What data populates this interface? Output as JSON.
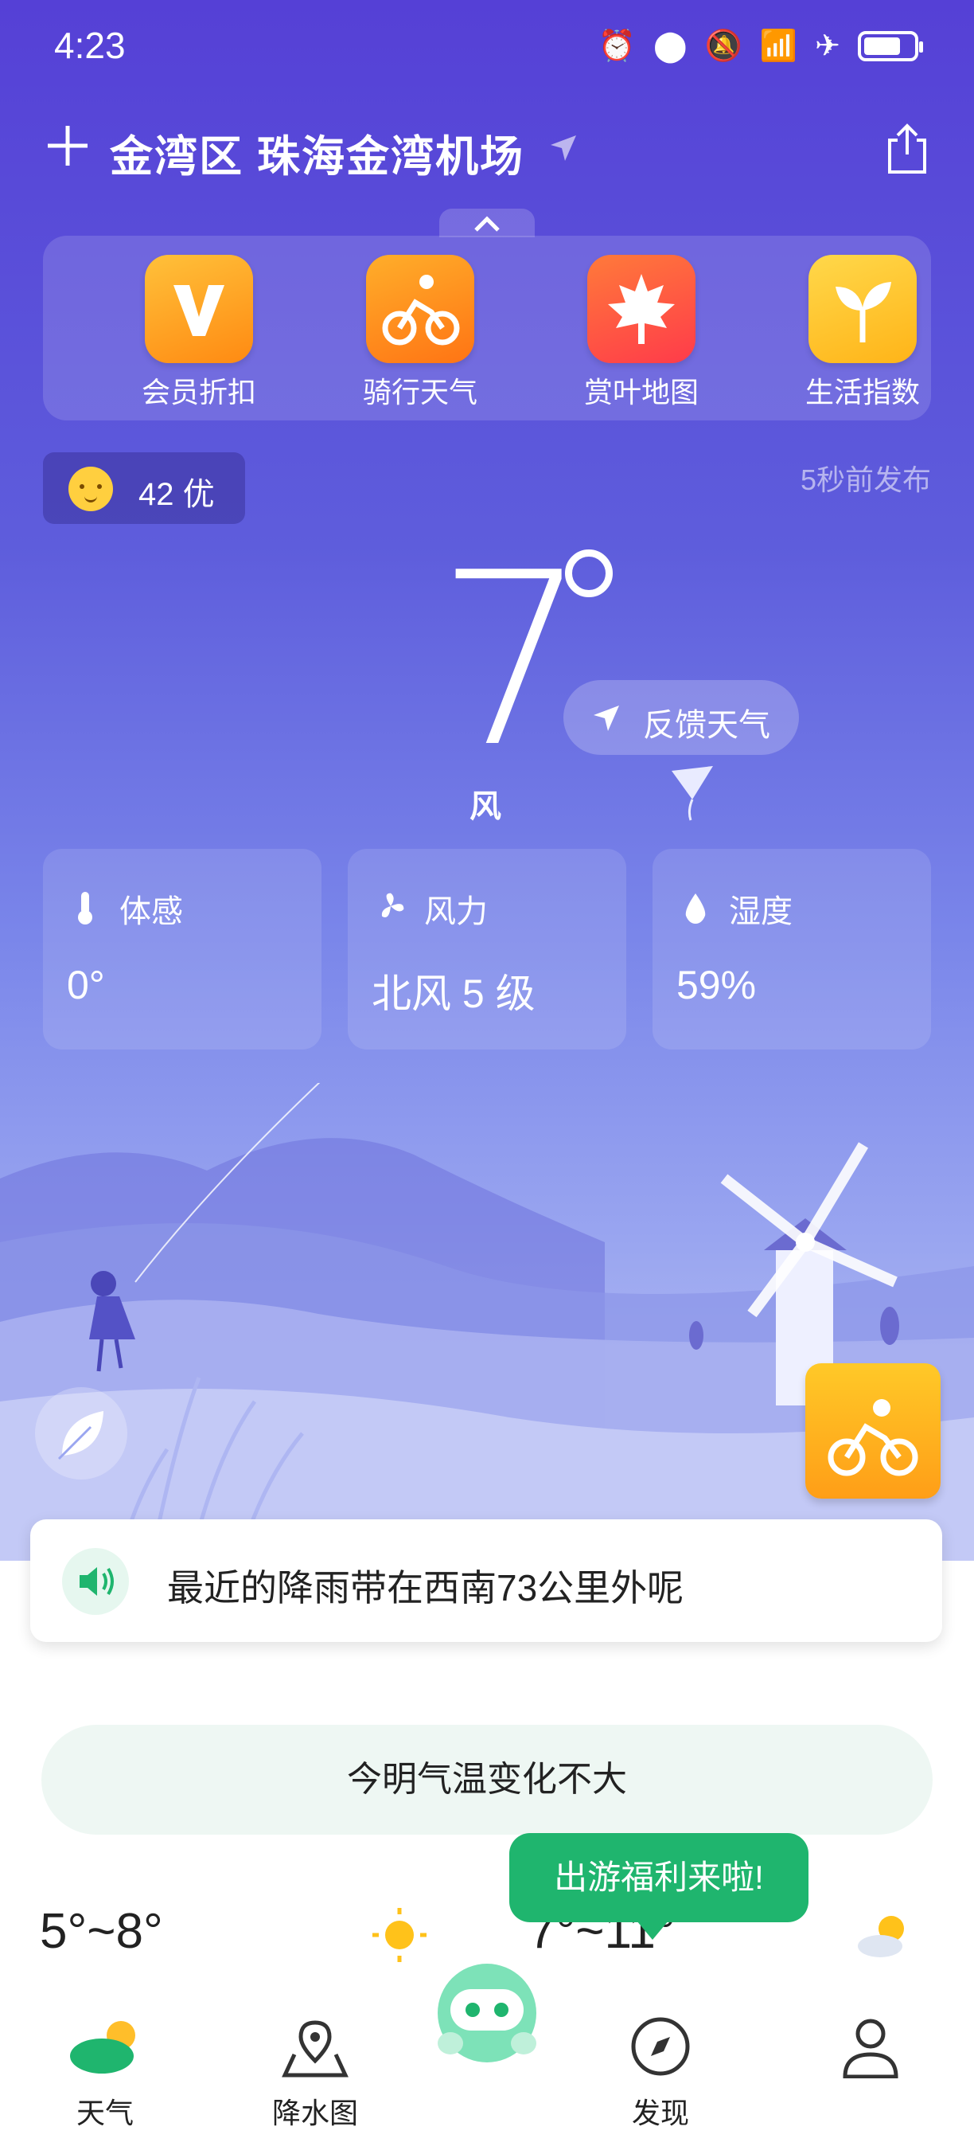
{
  "status_bar": {
    "time": "4:23",
    "icons": [
      "alarm-icon",
      "location-icon",
      "mute-icon",
      "wifi-icon",
      "airplane-icon",
      "battery-icon"
    ],
    "battery_level": 0.75
  },
  "header": {
    "location": "金湾区 珠海金湾机场",
    "add_icon": "plus-icon",
    "share_icon": "share-icon"
  },
  "quick_actions": [
    {
      "label": "会员折扣",
      "icon": "vip-icon",
      "color": "#ff9f1a"
    },
    {
      "label": "骑行天气",
      "icon": "bike-icon",
      "color": "#ff8a1d"
    },
    {
      "label": "赏叶地图",
      "icon": "maple-leaf-icon",
      "color": "#ff5a3a"
    },
    {
      "label": "生活指数",
      "icon": "sprout-icon",
      "color": "#ffc323"
    }
  ],
  "aqi": {
    "text": "42 优"
  },
  "publish_time": "5秒前发布",
  "current": {
    "temperature": "7",
    "condition": "风",
    "feedback_label": "反馈天气"
  },
  "details": [
    {
      "label": "体感",
      "value": "0°",
      "icon": "thermometer-icon"
    },
    {
      "label": "风力",
      "value": "北风 5 级",
      "icon": "fan-icon"
    },
    {
      "label": "湿度",
      "value": "59%",
      "icon": "droplet-icon"
    }
  ],
  "rain_notice": "最近的降雨带在西南73公里外呢",
  "temp_change": "今明气温变化不大",
  "forecast": [
    {
      "temp": "5°~8°",
      "icon": "sunny-icon"
    },
    {
      "temp": "7°~11°",
      "icon": "partly-cloudy-icon"
    }
  ],
  "promo": "出游福利来啦!",
  "nav": [
    {
      "label": "天气",
      "icon": "weather-icon",
      "active": true
    },
    {
      "label": "降水图",
      "icon": "map-pin-icon",
      "active": false
    },
    {
      "label": "",
      "icon": "robot-assistant-icon",
      "active": false
    },
    {
      "label": "发现",
      "icon": "compass-icon",
      "active": false
    },
    {
      "label": "",
      "icon": "profile-icon",
      "active": false
    }
  ],
  "colors": {
    "accent_green": "#1fb56e",
    "gradient_top": "#5540d6",
    "gradient_bottom": "#c3c9f6"
  }
}
